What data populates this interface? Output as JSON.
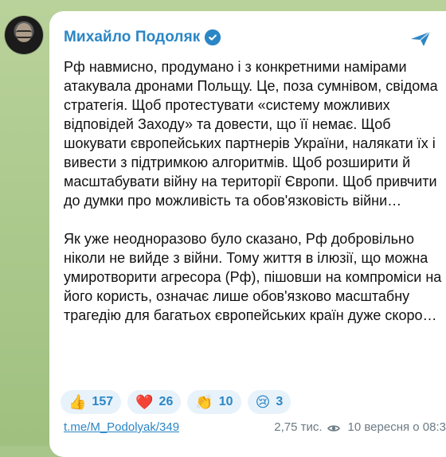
{
  "channel": {
    "name": "Михайло Подоляк",
    "link_text": "t.me/M_Podolyak/349",
    "views": "2,75 тис.",
    "date": "10 вересня о 08:3"
  },
  "message": {
    "paragraph1": "Рф навмисно, продумано і з конкретними намірами атакувала дронами Польщу. Це, поза сумнівом, свідома стратегія. Щоб протестувати «систему можливих відповідей Заходу» та довести, що її немає. Щоб шокувати європейських партнерів України, налякати їх і вивести з підтримкою алгоритмів. Щоб розширити й масштабувати війну на території Європи. Щоб привчити до думки про можливість та обов'язковість війни…",
    "paragraph2": "Як уже неодноразово було сказано, Рф добровільно ніколи не вийде з війни. Тому життя в ілюзії, що можна умиротворити агресора (Рф), пішовши на компроміси на його користь, означає лише обов'язково масштабну трагедію для багатьох європейських країн дуже скоро…"
  },
  "reactions": [
    {
      "emoji": "👍",
      "count": "157"
    },
    {
      "emoji": "❤️",
      "count": "26"
    },
    {
      "emoji": "👏",
      "count": "10"
    },
    {
      "emoji": "😢",
      "count": "3"
    }
  ],
  "icons": {
    "verified": "verified-badge-icon",
    "share": "share-icon",
    "views": "eye-icon"
  },
  "colors": {
    "accent": "#2b86c5",
    "bubble": "#ffffff",
    "background": "#a9c68a"
  }
}
